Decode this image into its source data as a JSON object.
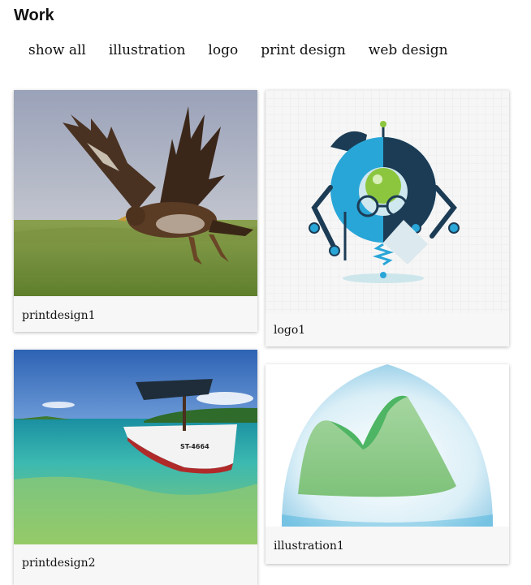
{
  "page": {
    "title": "Work"
  },
  "filters": [
    "show all",
    "illustration",
    "logo",
    "print design",
    "web design"
  ],
  "portfolio": {
    "items": [
      {
        "caption": "printdesign1",
        "image": "eagle-photo"
      },
      {
        "caption": "logo1",
        "image": "robot-logo"
      },
      {
        "caption": "printdesign2",
        "image": "boat-photo"
      },
      {
        "caption": "illustration1",
        "image": "mountain-illustration"
      }
    ]
  },
  "colors": {
    "logo_navy": "#1c3c55",
    "logo_blue": "#29a6d8",
    "logo_green": "#8cc63f",
    "mountain_green": "#5fbf6b"
  }
}
